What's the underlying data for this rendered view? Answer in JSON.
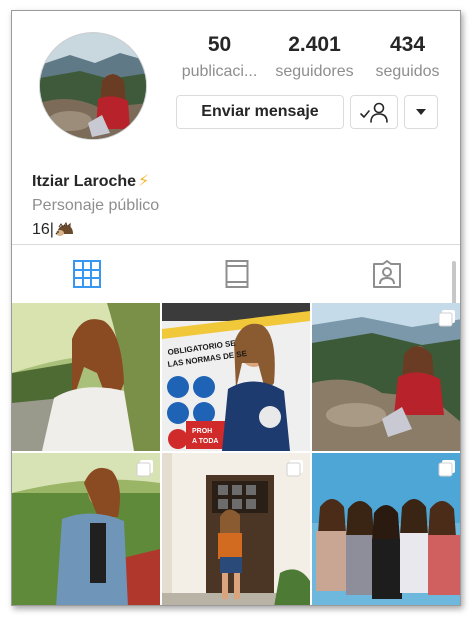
{
  "profile": {
    "name": "Itziar Laroche",
    "name_emoji": "⚡",
    "category": "Personaje público",
    "bio_text": "16|",
    "bio_emoji_icon": "hedgehog-icon"
  },
  "stats": [
    {
      "value": "50",
      "label": "publicaci..."
    },
    {
      "value": "2.401",
      "label": "seguidores"
    },
    {
      "value": "434",
      "label": "seguidos"
    }
  ],
  "buttons": {
    "message": "Enviar mensaje",
    "following_icon": "person-check-icon",
    "more_icon": "caret-down-icon"
  },
  "tabs": [
    {
      "id": "grid",
      "icon": "grid-icon",
      "active": true
    },
    {
      "id": "feed",
      "icon": "feed-icon",
      "active": false
    },
    {
      "id": "tagged",
      "icon": "tagged-icon",
      "active": false
    }
  ],
  "grid": {
    "multi_post_tiles": [
      2,
      3,
      4,
      5
    ],
    "tiles": 6
  },
  "sign": {
    "line1": "OBLIGATORIO SE",
    "line2": "LAS NORMAS DE SE",
    "tag1": "PROH",
    "tag2": "A TODA"
  },
  "colors": {
    "accent": "#3897f0",
    "text": "#262626",
    "muted": "#8e8e8e",
    "border": "#dbdbdb"
  }
}
